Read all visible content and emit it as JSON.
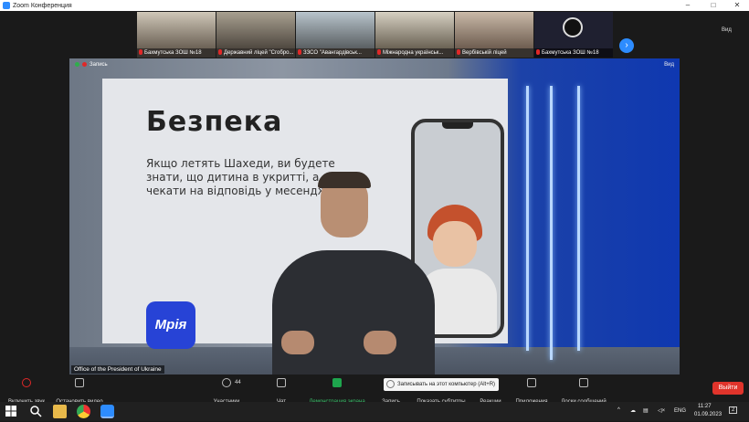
{
  "window": {
    "title": "Zoom Конференция",
    "controls": {
      "minimize": "–",
      "maximize": "□",
      "close": "✕"
    }
  },
  "gallery": {
    "tiles": [
      {
        "name": "Бахмутська ЗОШ №18"
      },
      {
        "name": "Державний ліцей \"Сгобро..."
      },
      {
        "name": "ЗЗСО \"Авангардівськ..."
      },
      {
        "name": "Міжнародна українськ..."
      },
      {
        "name": "Вербівській ліцей"
      },
      {
        "name": "Бахмутська ЗОШ №18"
      }
    ],
    "next_icon": "›",
    "view_label": "Вид"
  },
  "video": {
    "recording_label": "Запись",
    "view_label": "Вид",
    "speaker_name": "Office of the President of Ukraine",
    "slide_title": "Безпека",
    "slide_body": "Якщо летять Шахеди, ви будете знати, що дитина в укритті, а не чекати на відповідь у месенджері.",
    "app_logo_text": "Мрія",
    "accent_color": "#1c42a8"
  },
  "toolbar": {
    "audio_label": "Включить звук",
    "video_label": "Остановить видео",
    "participants_label": "Участники",
    "participants_count": "44",
    "chat_label": "Чат",
    "share_label": "Демонстрация экрана",
    "record_label": "Запись",
    "captions_label": "Показать субтитры",
    "reactions_label": "Реакции",
    "apps_label": "Приложения",
    "whiteboards_label": "Доски сообщений",
    "record_tooltip": "Записывать на этот компьютер (Alt+R)",
    "leave_label": "Выйти"
  },
  "taskbar": {
    "language": "ENG",
    "time": "11:27",
    "date": "01.09.2023",
    "notifications": "2"
  },
  "colors": {
    "zoom_blue": "#2d8cff",
    "share_green": "#1ea54d",
    "leave_red": "#e0342b"
  }
}
